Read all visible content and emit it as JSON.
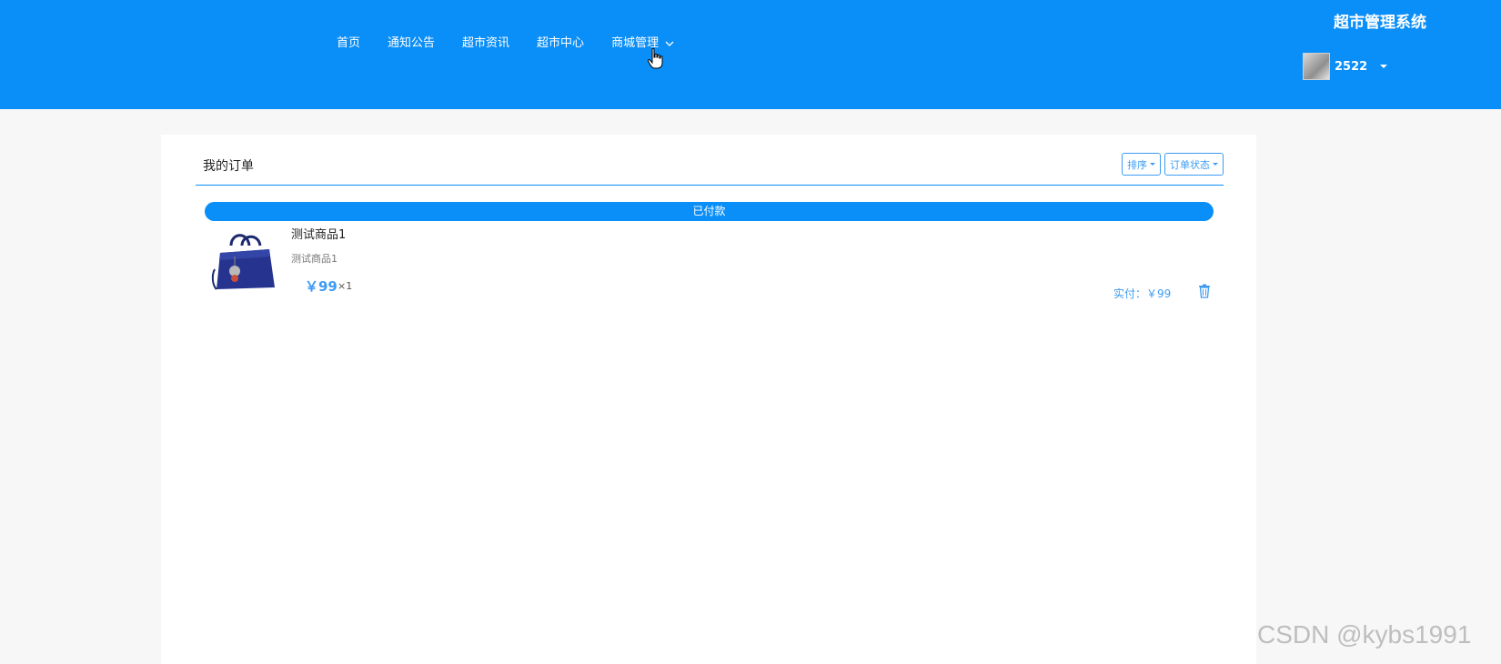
{
  "header": {
    "system_title": "超市管理系统",
    "nav": [
      {
        "label": "首页"
      },
      {
        "label": "通知公告"
      },
      {
        "label": "超市资讯"
      },
      {
        "label": "超市中心"
      },
      {
        "label": "商城管理"
      }
    ],
    "user": {
      "name": "2522"
    }
  },
  "orders": {
    "title": "我的订单",
    "filters": {
      "sort_label": "排序",
      "status_label": "订单状态"
    },
    "items": [
      {
        "status": "已付款",
        "product_name": "测试商品1",
        "product_desc": "测试商品1",
        "price": "￥99",
        "quantity": "×1",
        "paid": "实付：￥99"
      }
    ]
  },
  "watermark": "CSDN @kybs1991",
  "colors": {
    "primary": "#0a8ef7",
    "accent": "#3d9cf2"
  }
}
